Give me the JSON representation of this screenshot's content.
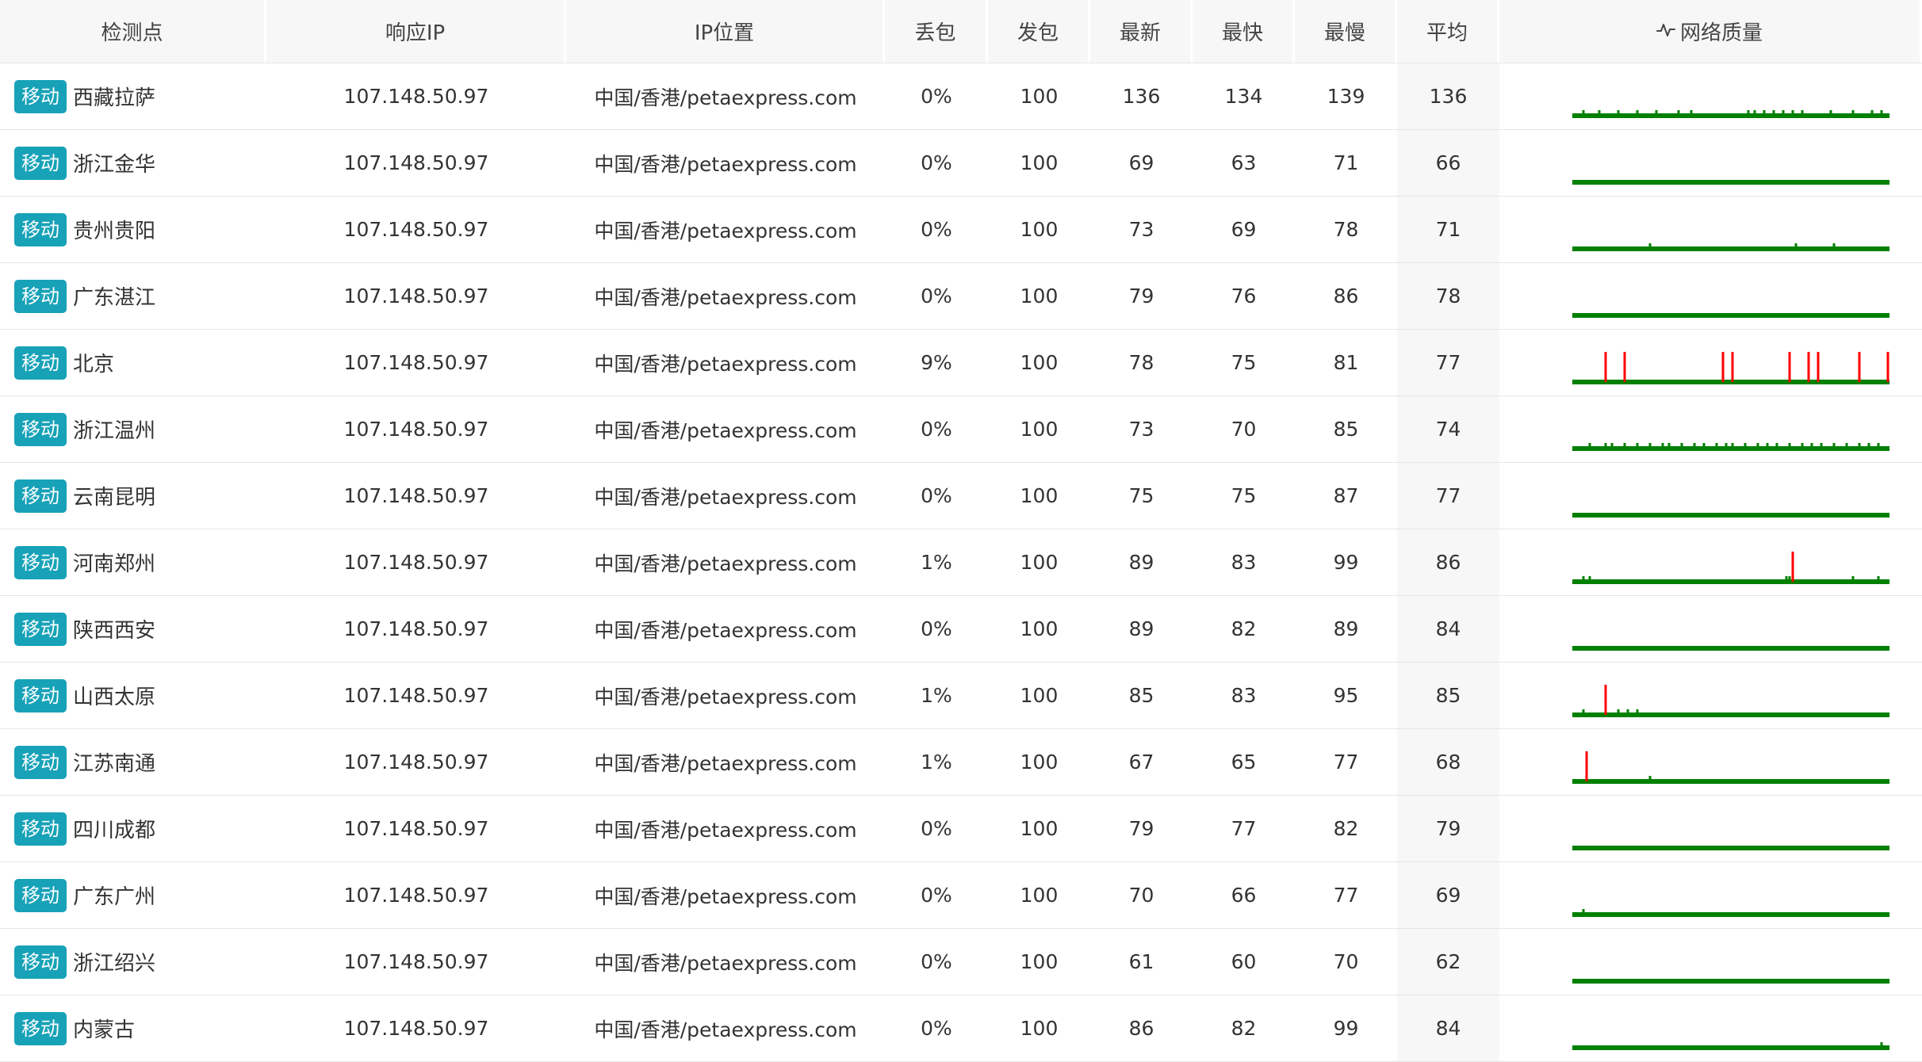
{
  "header": {
    "station": "检测点",
    "ip": "响应IP",
    "location": "IP位置",
    "loss": "丢包",
    "sent": "发包",
    "latest": "最新",
    "fastest": "最快",
    "slowest": "最慢",
    "average": "平均",
    "quality": "网络质量",
    "quality_icon": "activity-icon"
  },
  "colors": {
    "badge": "#17a2b8",
    "good": "#008000",
    "loss": "#ff0000"
  },
  "rows": [
    {
      "isp": "移动",
      "station": "西藏拉萨",
      "ip": "107.148.50.97",
      "location": "中国/香港/petaexpress.com",
      "loss": "0%",
      "sent": "100",
      "latest": "136",
      "fastest": "134",
      "slowest": "139",
      "average": "136",
      "quality": {
        "lost_packets": [],
        "jitter_ticks": [
          3,
          8,
          14,
          20,
          26,
          33,
          37,
          55,
          57,
          60,
          63,
          66,
          69,
          72,
          81,
          88,
          94,
          97
        ]
      }
    },
    {
      "isp": "移动",
      "station": "浙江金华",
      "ip": "107.148.50.97",
      "location": "中国/香港/petaexpress.com",
      "loss": "0%",
      "sent": "100",
      "latest": "69",
      "fastest": "63",
      "slowest": "71",
      "average": "66",
      "quality": {
        "lost_packets": [],
        "jitter_ticks": []
      }
    },
    {
      "isp": "移动",
      "station": "贵州贵阳",
      "ip": "107.148.50.97",
      "location": "中国/香港/petaexpress.com",
      "loss": "0%",
      "sent": "100",
      "latest": "73",
      "fastest": "69",
      "slowest": "78",
      "average": "71",
      "quality": {
        "lost_packets": [],
        "jitter_ticks": [
          24,
          70,
          82
        ]
      }
    },
    {
      "isp": "移动",
      "station": "广东湛江",
      "ip": "107.148.50.97",
      "location": "中国/香港/petaexpress.com",
      "loss": "0%",
      "sent": "100",
      "latest": "79",
      "fastest": "76",
      "slowest": "86",
      "average": "78",
      "quality": {
        "lost_packets": [],
        "jitter_ticks": []
      }
    },
    {
      "isp": "移动",
      "station": "北京",
      "ip": "107.148.50.97",
      "location": "中国/香港/petaexpress.com",
      "loss": "9%",
      "sent": "100",
      "latest": "78",
      "fastest": "75",
      "slowest": "81",
      "average": "77",
      "quality": {
        "lost_packets": [
          10,
          16,
          47,
          50,
          68,
          74,
          77,
          90,
          99
        ],
        "jitter_ticks": []
      }
    },
    {
      "isp": "移动",
      "station": "浙江温州",
      "ip": "107.148.50.97",
      "location": "中国/香港/petaexpress.com",
      "loss": "0%",
      "sent": "100",
      "latest": "73",
      "fastest": "70",
      "slowest": "85",
      "average": "74",
      "quality": {
        "lost_packets": [],
        "jitter_ticks": [
          5,
          10,
          12,
          16,
          20,
          24,
          28,
          30,
          34,
          38,
          41,
          45,
          48,
          50,
          54,
          58,
          61,
          64,
          68,
          72,
          75,
          78,
          82,
          86,
          90,
          93,
          96
        ]
      }
    },
    {
      "isp": "移动",
      "station": "云南昆明",
      "ip": "107.148.50.97",
      "location": "中国/香港/petaexpress.com",
      "loss": "0%",
      "sent": "100",
      "latest": "75",
      "fastest": "75",
      "slowest": "87",
      "average": "77",
      "quality": {
        "lost_packets": [],
        "jitter_ticks": []
      }
    },
    {
      "isp": "移动",
      "station": "河南郑州",
      "ip": "107.148.50.97",
      "location": "中国/香港/petaexpress.com",
      "loss": "1%",
      "sent": "100",
      "latest": "89",
      "fastest": "83",
      "slowest": "99",
      "average": "86",
      "quality": {
        "lost_packets": [
          69
        ],
        "jitter_ticks": [
          3,
          5,
          67,
          68,
          88,
          96
        ]
      }
    },
    {
      "isp": "移动",
      "station": "陕西西安",
      "ip": "107.148.50.97",
      "location": "中国/香港/petaexpress.com",
      "loss": "0%",
      "sent": "100",
      "latest": "89",
      "fastest": "82",
      "slowest": "89",
      "average": "84",
      "quality": {
        "lost_packets": [],
        "jitter_ticks": []
      }
    },
    {
      "isp": "移动",
      "station": "山西太原",
      "ip": "107.148.50.97",
      "location": "中国/香港/petaexpress.com",
      "loss": "1%",
      "sent": "100",
      "latest": "85",
      "fastest": "83",
      "slowest": "95",
      "average": "85",
      "quality": {
        "lost_packets": [
          10
        ],
        "jitter_ticks": [
          3,
          14,
          17,
          20
        ]
      }
    },
    {
      "isp": "移动",
      "station": "江苏南通",
      "ip": "107.148.50.97",
      "location": "中国/香港/petaexpress.com",
      "loss": "1%",
      "sent": "100",
      "latest": "67",
      "fastest": "65",
      "slowest": "77",
      "average": "68",
      "quality": {
        "lost_packets": [
          4
        ],
        "jitter_ticks": [
          24
        ]
      }
    },
    {
      "isp": "移动",
      "station": "四川成都",
      "ip": "107.148.50.97",
      "location": "中国/香港/petaexpress.com",
      "loss": "0%",
      "sent": "100",
      "latest": "79",
      "fastest": "77",
      "slowest": "82",
      "average": "79",
      "quality": {
        "lost_packets": [],
        "jitter_ticks": []
      }
    },
    {
      "isp": "移动",
      "station": "广东广州",
      "ip": "107.148.50.97",
      "location": "中国/香港/petaexpress.com",
      "loss": "0%",
      "sent": "100",
      "latest": "70",
      "fastest": "66",
      "slowest": "77",
      "average": "69",
      "quality": {
        "lost_packets": [],
        "jitter_ticks": [
          3
        ]
      }
    },
    {
      "isp": "移动",
      "station": "浙江绍兴",
      "ip": "107.148.50.97",
      "location": "中国/香港/petaexpress.com",
      "loss": "0%",
      "sent": "100",
      "latest": "61",
      "fastest": "60",
      "slowest": "70",
      "average": "62",
      "quality": {
        "lost_packets": [],
        "jitter_ticks": []
      }
    },
    {
      "isp": "移动",
      "station": "内蒙古",
      "ip": "107.148.50.97",
      "location": "中国/香港/petaexpress.com",
      "loss": "0%",
      "sent": "100",
      "latest": "86",
      "fastest": "82",
      "slowest": "99",
      "average": "84",
      "quality": {
        "lost_packets": [],
        "jitter_ticks": [
          97
        ]
      }
    }
  ]
}
